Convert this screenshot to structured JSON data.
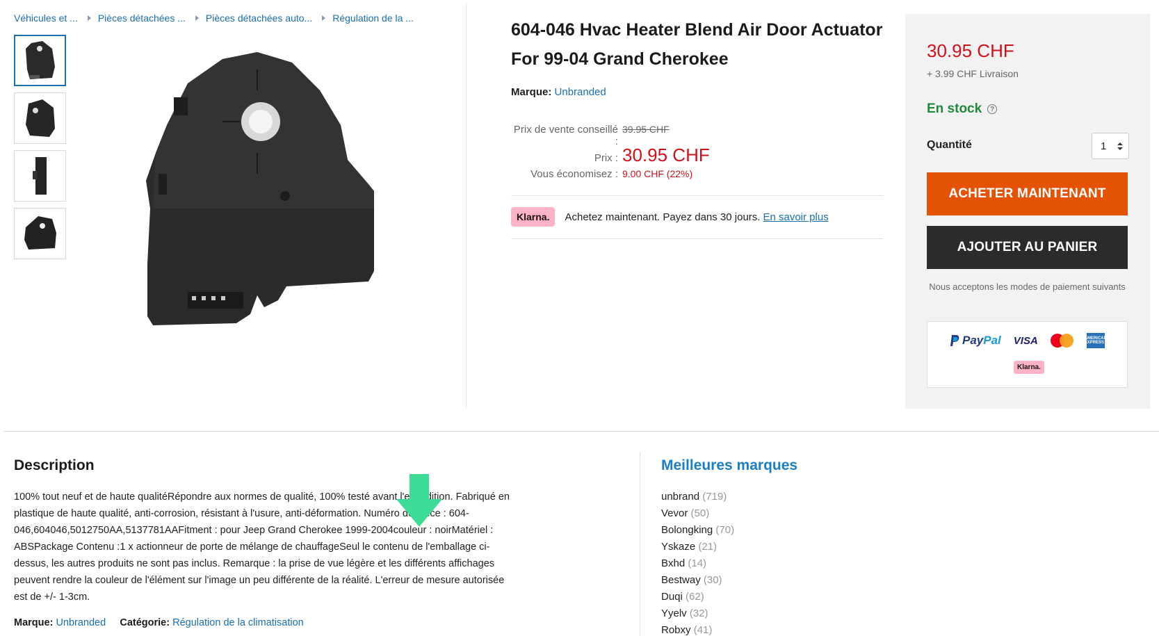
{
  "breadcrumb": [
    "Véhicules et ...",
    "Pièces détachées ...",
    "Pièces détachées auto...",
    "Régulation de la ..."
  ],
  "product": {
    "title": "604-046 Hvac Heater Blend Air Door Actuator For 99-04 Grand Cherokee",
    "brand_label": "Marque:",
    "brand_value": "Unbranded",
    "rrp_label": "Prix de vente conseillé :",
    "rrp_value": "39.95 CHF",
    "price_label": "Prix :",
    "price_value": "30.95 CHF",
    "save_label": "Vous économisez :",
    "save_value": "9.00 CHF (22%)"
  },
  "klarna": {
    "badge": "Klarna.",
    "text": "Achetez maintenant. Payez dans 30 jours.",
    "link": "En savoir plus"
  },
  "buybox": {
    "price": "30.95 CHF",
    "delivery": "+ 3.99 CHF Livraison",
    "stock": "En stock",
    "qty_label": "Quantité",
    "qty_value": "1",
    "buy_now": "ACHETER MAINTENANT",
    "add_cart": "AJOUTER AU PANIER",
    "accept_text": "Nous acceptons les modes de paiement suivants",
    "payments": [
      "PayPal",
      "VISA",
      "Mastercard",
      "American Express",
      "Klarna."
    ],
    "paypal_pay": "Pay",
    "paypal_pal": "Pal",
    "visa": "VISA",
    "amex": "AMERICAN EXPRESS",
    "klarna": "Klarna."
  },
  "description": {
    "title": "Description",
    "text": "100% tout neuf et de haute qualitéRépondre aux normes de qualité, 100% testé avant l'expédition. Fabriqué en plastique de haute qualité, anti-corrosion, résistant à l'usure, anti-déformation. Numéro de pièce : 604-046,604046,5012750AA,5137781AAFitment : pour Jeep Grand Cherokee 1999-2004couleur : noirMatériel : ABSPackage Contenu :1 x actionneur de porte de mélange de chauffageSeul le contenu de l'emballage ci-dessus, les autres produits ne sont pas inclus. Remarque : la prise de vue légère et les différents affichages peuvent rendre la couleur de l'élément sur l'image un peu différente de la réalité. L'erreur de mesure autorisée est de +/- 1-3cm.",
    "brand_label": "Marque:",
    "brand_value": "Unbranded",
    "category_label": "Catégorie:",
    "category_value": "Régulation de la climatisation"
  },
  "top_brands": {
    "title": "Meilleures marques",
    "items": [
      {
        "name": "unbrand",
        "count": "(719)"
      },
      {
        "name": "Vevor",
        "count": "(50)"
      },
      {
        "name": "Bolongking",
        "count": "(70)"
      },
      {
        "name": "Yskaze",
        "count": "(21)"
      },
      {
        "name": "Bxhd",
        "count": "(14)"
      },
      {
        "name": "Bestway",
        "count": "(30)"
      },
      {
        "name": "Duqi",
        "count": "(62)"
      },
      {
        "name": "Yyelv",
        "count": "(32)"
      },
      {
        "name": "Robxy",
        "count": "(41)"
      }
    ]
  },
  "colors": {
    "link": "#1a6fb0",
    "price": "#d0101b",
    "stock": "#1f8a3b",
    "buy_now": "#e35205",
    "add_cart": "#2b2b2b",
    "klarna": "#ffb3c7",
    "overlay_arrow": "#3ddc97"
  },
  "icons": {
    "breadcrumb_sep": "caret-right-icon",
    "stock_help": "help-circle-icon",
    "qty": "up-down-arrows-icon",
    "overlay": "down-arrow-icon"
  }
}
